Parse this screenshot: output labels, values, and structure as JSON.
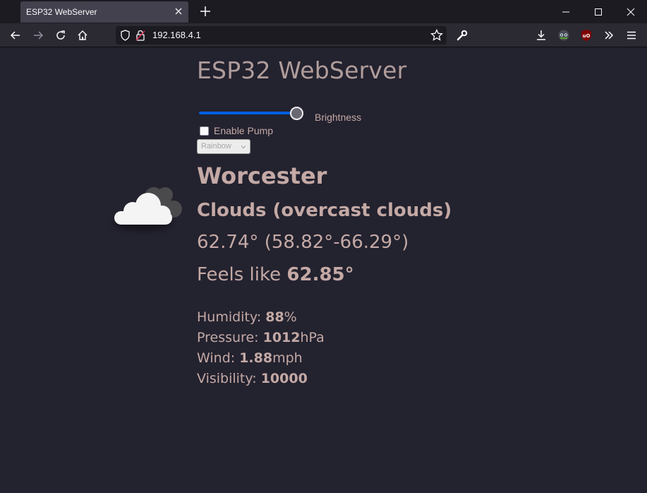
{
  "browser": {
    "tab_title": "ESP32 WebServer",
    "url": "192.168.4.1"
  },
  "page": {
    "title": "ESP32 WebServer",
    "brightness_label": "Brightness",
    "brightness_value": 0.95,
    "pump_label": "Enable Pump",
    "pump_checked": false,
    "mode_selected": "Rainbow",
    "city": "Worcester",
    "condition": "Clouds (overcast clouds)",
    "temp": "62.74°",
    "temp_range": "(58.82°-66.29°)",
    "feels_label": "Feels like",
    "feels_value": "62.85°",
    "humidity_label": "Humidity:",
    "humidity_value": "88",
    "humidity_unit": "%",
    "pressure_label": "Pressure:",
    "pressure_value": "1012",
    "pressure_unit": "hPa",
    "wind_label": "Wind:",
    "wind_value": "1.88",
    "wind_unit": "mph",
    "visibility_label": "Visibility:",
    "visibility_value": "10000"
  },
  "icons": {
    "weather": "overcast-clouds-icon"
  },
  "colors": {
    "text": "#c4a9a5",
    "background": "#23222f",
    "slider_accent": "#0060df"
  }
}
